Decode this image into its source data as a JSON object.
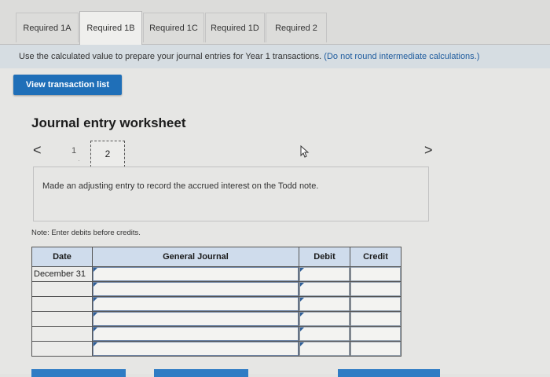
{
  "tabs": [
    {
      "label": "Required 1A",
      "active": false
    },
    {
      "label": "Required 1B",
      "active": true
    },
    {
      "label": "Required 1C",
      "active": false
    },
    {
      "label": "Required 1D",
      "active": false
    },
    {
      "label": "Required 2",
      "active": false
    }
  ],
  "instruction": {
    "text": "Use the calculated value to prepare your journal entries for Year 1 transactions.",
    "highlight": "(Do not round intermediate calculations.)"
  },
  "view_button": "View transaction list",
  "worksheet": {
    "title": "Journal entry worksheet",
    "pages": [
      "1",
      "2"
    ],
    "current_page": "2",
    "prev_icon": "<",
    "next_icon": ">",
    "description": "Made an adjusting entry to record the accrued interest on the Todd note.",
    "note": "Note: Enter debits before credits."
  },
  "table": {
    "headers": {
      "date": "Date",
      "journal": "General Journal",
      "debit": "Debit",
      "credit": "Credit"
    },
    "rows": [
      {
        "date": "December 31",
        "journal": "",
        "debit": "",
        "credit": ""
      },
      {
        "date": "",
        "journal": "",
        "debit": "",
        "credit": ""
      },
      {
        "date": "",
        "journal": "",
        "debit": "",
        "credit": ""
      },
      {
        "date": "",
        "journal": "",
        "debit": "",
        "credit": ""
      },
      {
        "date": "",
        "journal": "",
        "debit": "",
        "credit": ""
      },
      {
        "date": "",
        "journal": "",
        "debit": "",
        "credit": ""
      }
    ]
  },
  "colors": {
    "accent": "#1f6fb8",
    "header_bg": "#cfdcec",
    "instruction_bg": "#d6dde2"
  }
}
